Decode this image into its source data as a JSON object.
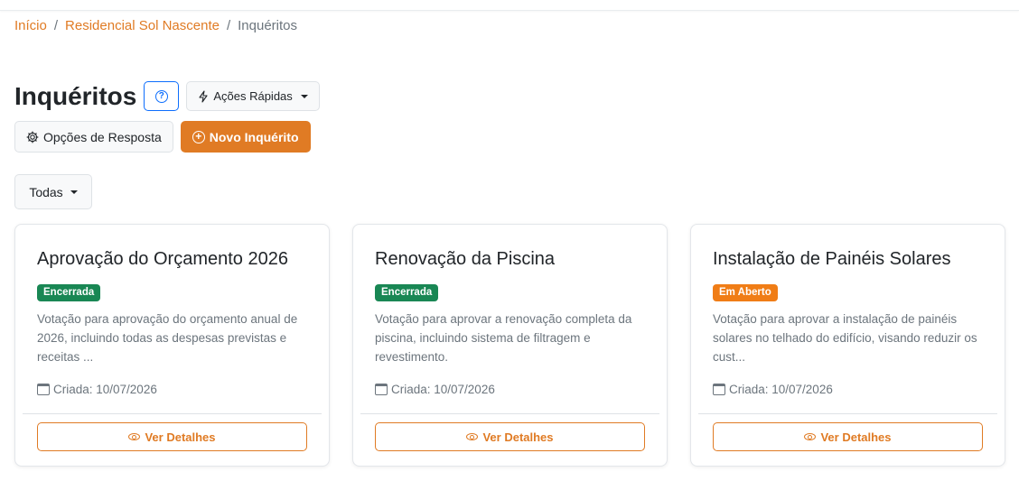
{
  "breadcrumb": {
    "home": "Início",
    "condo": "Residencial Sol Nascente",
    "current": "Inquéritos",
    "separator": "/"
  },
  "header": {
    "title": "Inquéritos",
    "help_symbol": "?",
    "quick_actions_label": "Ações Rápidas",
    "response_options_label": "Opções de Resposta",
    "new_inquiry_label": "Novo Inquérito"
  },
  "filter": {
    "selected": "Todas"
  },
  "cards": [
    {
      "title": "Aprovação do Orçamento 2026",
      "status": "Encerrada",
      "description": "Votação para aprovação do orçamento anual de 2026, incluindo todas as despesas previstas e receitas ...",
      "created": "Criada: 10/07/2026",
      "details_label": "Ver Detalhes"
    },
    {
      "title": "Renovação da Piscina",
      "status": "Encerrada",
      "description": "Votação para aprovar a renovação completa da piscina, incluindo sistema de filtragem e revestimento.",
      "created": "Criada: 10/07/2026",
      "details_label": "Ver Detalhes"
    },
    {
      "title": "Instalação de Painéis Solares",
      "status": "Em Aberto",
      "description": "Votação para aprovar a instalação de painéis solares no telhado do edifício, visando reduzir os cust...",
      "created": "Criada: 10/07/2026",
      "details_label": "Ver Detalhes"
    }
  ],
  "colors": {
    "accent": "#e07b24",
    "status_closed": "#198754",
    "status_open": "#f07d16",
    "help_border": "#0d6efd"
  }
}
